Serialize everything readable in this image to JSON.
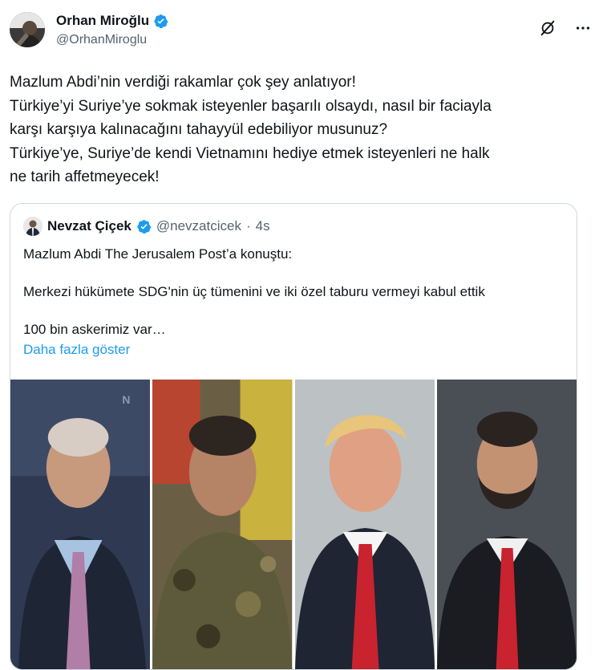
{
  "author": {
    "display_name": "Orhan Miroğlu",
    "handle": "@OrhanMiroglu",
    "avatar_icon": "user-avatar"
  },
  "actions": {
    "grok_icon": "grok-icon",
    "more_icon": "more-icon"
  },
  "tweet": {
    "lines": [
      "Mazlum Abdi’nin verdiği rakamlar çok şey anlatıyor!",
      "Türkiye’yi Suriye’ye sokmak isteyenler başarılı olsaydı, nasıl bir faciayla",
      "karşı karşıya kalınacağını tahayyül edebiliyor musunuz?",
      "Türkiye’ye, Suriye’de kendi Vietnamını hediye etmek isteyenleri ne halk",
      "ne tarih affetmeyecek!"
    ]
  },
  "quote": {
    "display_name": "Nevzat Çiçek",
    "handle": "@nevzatcicek",
    "separator": "·",
    "time": "4s",
    "lines": [
      "Mazlum Abdi The Jerusalem Post’a konuştu:",
      "Merkezi hükümete SDG'nin üç tümenini ve iki özel taburu vermeyi kabul ettik",
      "100 bin askerimiz var…"
    ],
    "show_more": "Daha fazla göster",
    "photos_count": 4
  },
  "colors": {
    "link": "#1d9bf0",
    "secondary_text": "#536471",
    "verified": "#1d9bf0",
    "border": "#cfd9de"
  }
}
